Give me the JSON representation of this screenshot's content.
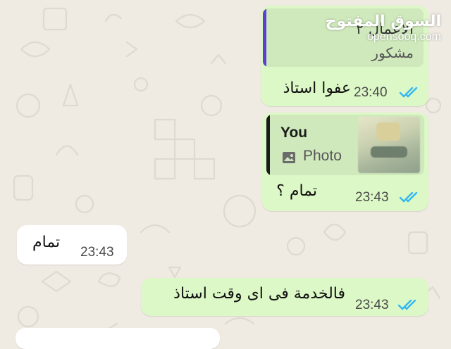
{
  "colors": {
    "outgoing_bubble": "#dcf8c6",
    "incoming_bubble": "#ffffff",
    "read_ticks": "#34b7f1",
    "quote_bar_purple": "#5b3fd6",
    "quote_bar_dark": "#1a1a1a"
  },
  "watermark": {
    "arabic": "السوق المفتوح",
    "latin": "opensooq.com"
  },
  "messages": [
    {
      "quote": {
        "title": "الأعمال ٢",
        "body": "مشكور"
      },
      "text": "عفوا استاذ",
      "time": "23:40",
      "status_icon": "double-check-icon"
    },
    {
      "quote": {
        "author": "You",
        "type_label": "Photo",
        "type_icon": "image-icon"
      },
      "text": "تمام ؟",
      "time": "23:43",
      "status_icon": "double-check-icon"
    },
    {
      "text": "تمام",
      "time": "23:43"
    },
    {
      "text": "فالخدمة فى اى وقت استاذ",
      "time": "23:43",
      "status_icon": "double-check-icon"
    }
  ]
}
